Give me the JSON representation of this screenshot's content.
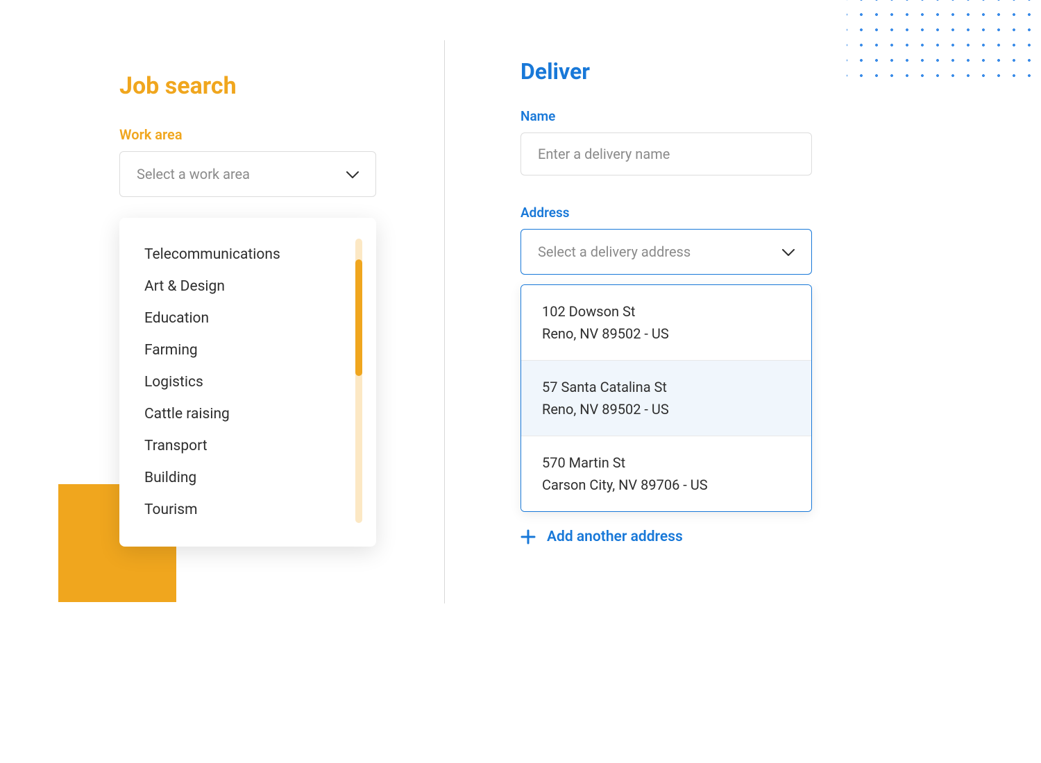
{
  "left": {
    "title": "Job search",
    "work_area_label": "Work area",
    "select_placeholder": "Select a work area",
    "options": [
      "Telecommunications",
      "Art & Design",
      "Education",
      "Farming",
      "Logistics",
      "Cattle raising",
      "Transport",
      "Building",
      "Tourism"
    ]
  },
  "right": {
    "title": "Deliver",
    "name_label": "Name",
    "name_placeholder": "Enter a delivery name",
    "address_label": "Address",
    "address_placeholder": "Select a delivery address",
    "addresses": [
      {
        "line1": "102 Dowson St",
        "line2": "Reno, NV 89502 - US",
        "highlighted": false
      },
      {
        "line1": "57 Santa Catalina St",
        "line2": "Reno, NV 89502 - US",
        "highlighted": true
      },
      {
        "line1": "570 Martin St",
        "line2": "Carson City, NV 89706 - US",
        "highlighted": false
      }
    ],
    "add_label": "Add another address"
  },
  "colors": {
    "orange": "#f0a61e",
    "blue": "#1878d8"
  }
}
